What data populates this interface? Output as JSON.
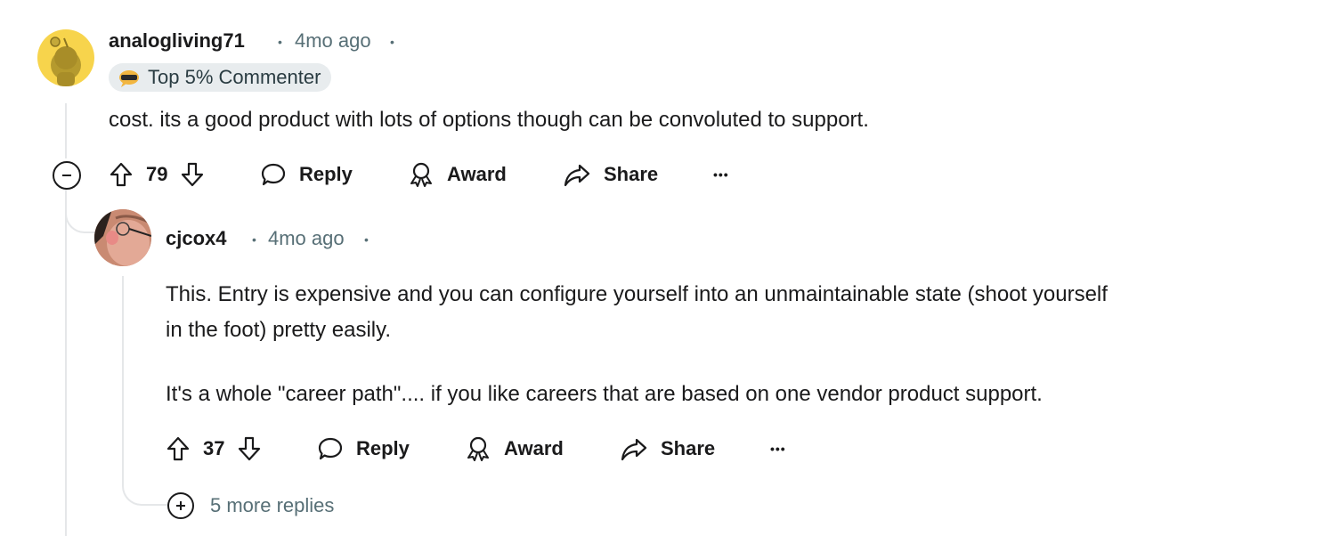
{
  "comments": [
    {
      "username": "analogliving71",
      "separator": "•",
      "timestamp": "4mo ago",
      "badge": {
        "icon": "sunglasses-speech-bubble-icon",
        "label": "Top 5% Commenter"
      },
      "avatar": {
        "icon": "snoo-avatar-icon",
        "bg_color": "#f7d44c"
      },
      "body": [
        "cost. its a good product with lots of options though can be convoluted to support."
      ],
      "votes": "79",
      "actions": {
        "reply": "Reply",
        "award": "Award",
        "share": "Share",
        "more": "•••"
      }
    },
    {
      "username": "cjcox4",
      "separator": "•",
      "timestamp": "4mo ago",
      "avatar": {
        "icon": "user-photo-avatar"
      },
      "body": [
        "This. Entry is expensive and you can configure yourself into an unmaintainable state (shoot yourself",
        "in the foot) pretty easily.",
        "It's a whole \"career path\".... if you like careers that are based on one vendor product support."
      ],
      "votes": "37",
      "actions": {
        "reply": "Reply",
        "award": "Award",
        "share": "Share",
        "more": "•••"
      },
      "more_replies": "5 more replies"
    }
  ]
}
